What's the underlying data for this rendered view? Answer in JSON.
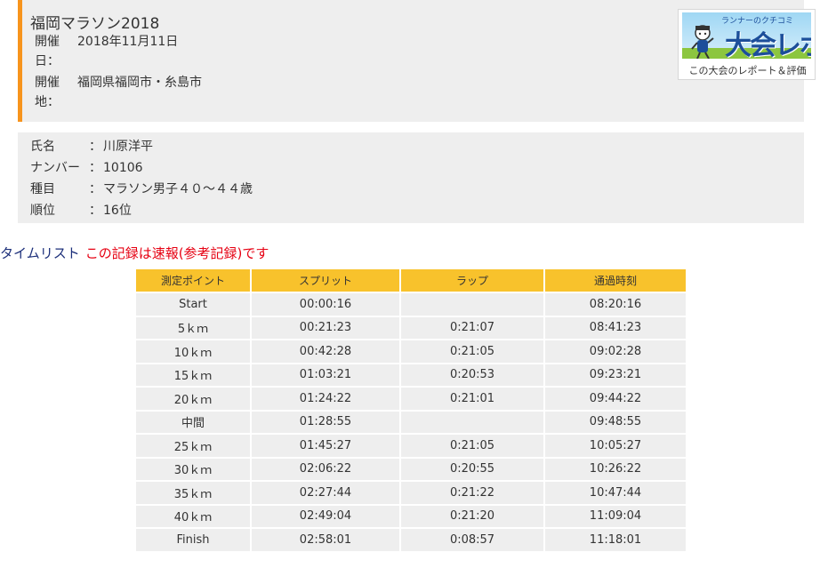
{
  "event": {
    "title": "福岡マラソン2018",
    "date_label": "開催日：",
    "date_value": "2018年11月11日",
    "place_label": "開催地：",
    "place_value": "福岡県福岡市・糸島市"
  },
  "banner": {
    "small_text": "ランナーのクチコミ",
    "big_text": "大会レポ",
    "caption": "この大会のレポート＆評価"
  },
  "runner": {
    "name_label": "氏名",
    "name_value": "川原洋平",
    "number_label": "ナンバー",
    "number_value": "10106",
    "category_label": "種目",
    "category_value": "マラソン男子４０〜４４歳",
    "rank_label": "順位",
    "rank_value": "16位",
    "colon": "："
  },
  "timelist": {
    "label": "タイムリスト",
    "note": "この記録は速報(参考記録)です",
    "headers": [
      "測定ポイント",
      "スプリット",
      "ラップ",
      "通過時刻"
    ],
    "rows": [
      [
        "Start",
        "00:00:16",
        "",
        "08:20:16"
      ],
      [
        "5ｋｍ",
        "00:21:23",
        "0:21:07",
        "08:41:23"
      ],
      [
        "10ｋｍ",
        "00:42:28",
        "0:21:05",
        "09:02:28"
      ],
      [
        "15ｋｍ",
        "01:03:21",
        "0:20:53",
        "09:23:21"
      ],
      [
        "20ｋｍ",
        "01:24:22",
        "0:21:01",
        "09:44:22"
      ],
      [
        "中間",
        "01:28:55",
        "",
        "09:48:55"
      ],
      [
        "25ｋｍ",
        "01:45:27",
        "0:21:05",
        "10:05:27"
      ],
      [
        "30ｋｍ",
        "02:06:22",
        "0:20:55",
        "10:26:22"
      ],
      [
        "35ｋｍ",
        "02:27:44",
        "0:21:22",
        "10:47:44"
      ],
      [
        "40ｋｍ",
        "02:49:04",
        "0:21:20",
        "11:09:04"
      ],
      [
        "Finish",
        "02:58:01",
        "0:08:57",
        "11:18:01"
      ]
    ]
  },
  "colors": {
    "accent_border": "#f7941d",
    "panel_bg": "#eeeeee",
    "table_header_bg": "#f8c22c",
    "timelist_label": "#1c2f7a",
    "note_red": "#e60012"
  }
}
